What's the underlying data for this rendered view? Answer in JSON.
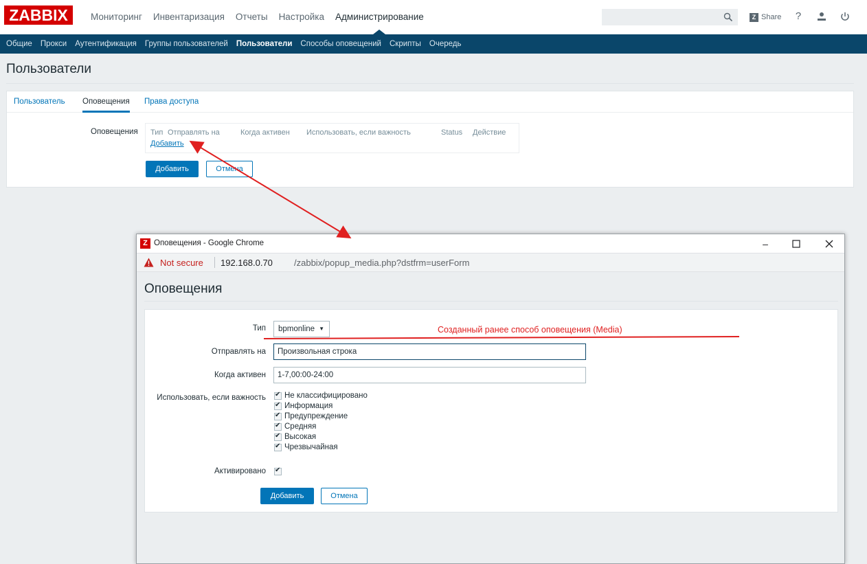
{
  "header": {
    "logo": "ZABBIX",
    "nav": [
      "Мониторинг",
      "Инвентаризация",
      "Отчеты",
      "Настройка",
      "Администрирование"
    ],
    "search_value": "",
    "share_label": "Share",
    "help_glyph": "?",
    "icons": [
      "search-icon",
      "user-icon",
      "power-icon"
    ]
  },
  "subnav": [
    "Общие",
    "Прокси",
    "Аутентификация",
    "Группы пользователей",
    "Пользователи",
    "Способы оповещений",
    "Скрипты",
    "Очередь"
  ],
  "page": {
    "title": "Пользователи",
    "tabs": [
      "Пользователь",
      "Оповещения",
      "Права доступа"
    ],
    "media_label": "Оповещения",
    "media_table_headers": [
      "Тип",
      "Отправлять на",
      "Когда активен",
      "Использовать, если важность",
      "Status",
      "Действие"
    ],
    "media_add_link": "Добавить",
    "add_button": "Добавить",
    "cancel_button": "Отмена"
  },
  "popup": {
    "window_title": "Оповещения - Google Chrome",
    "not_secure": "Not secure",
    "url_host": "192.168.0.70",
    "url_path": "/zabbix/popup_media.php?dstfrm=userForm",
    "title": "Оповещения",
    "type_label": "Тип",
    "type_value": "bpmonline",
    "annotation": "Созданный ранее способ оповещения (Media)",
    "sendto_label": "Отправлять на",
    "sendto_value": "Произвольная строка",
    "period_label": "Когда активен",
    "period_value": "1-7,00:00-24:00",
    "severity_label": "Использовать, если важность",
    "severities": [
      "Не классифицировано",
      "Информация",
      "Предупреждение",
      "Средняя",
      "Высокая",
      "Чрезвычайная"
    ],
    "enabled_label": "Активировано",
    "add_button": "Добавить",
    "cancel_button": "Отмена"
  },
  "colors": {
    "brand": "#d40000",
    "subnav": "#0a466a",
    "link": "#0275b8",
    "annotation": "#e02020"
  }
}
